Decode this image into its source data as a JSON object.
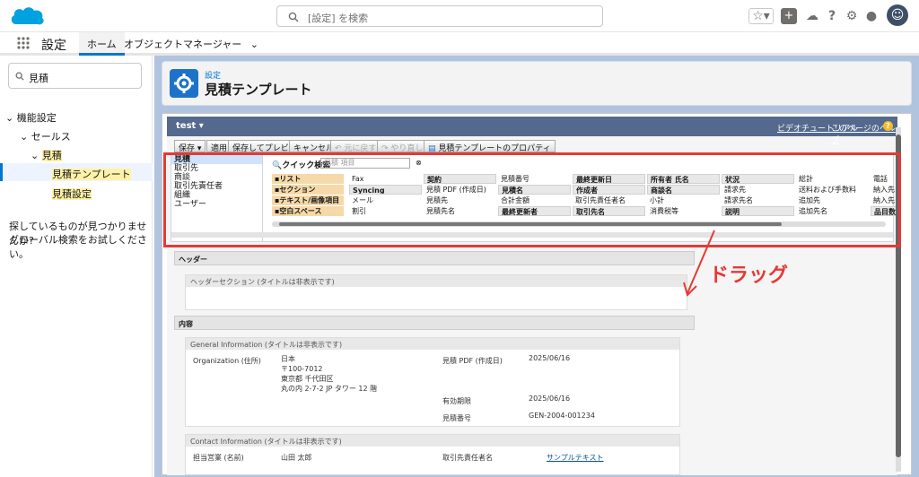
{
  "topbar": {
    "search_placeholder": "[設定] を検索"
  },
  "appbar": {
    "app_name": "設定",
    "tabs": [
      "ホーム",
      "オブジェクトマネージャー"
    ]
  },
  "sidebar": {
    "quickfind_value": "見積",
    "tree": [
      "機能設定",
      "セールス",
      "見積",
      "見積テンプレート",
      "見積設定"
    ],
    "notfound": "探しているものが見つかりませんか?",
    "global": "グローバル検索をお試しください。"
  },
  "header": {
    "breadcrumb": "設定",
    "title": "見積テンプレート"
  },
  "editor": {
    "name": "test",
    "help1": "ビデオチュートリアル",
    "help2": "このページのヘルプ",
    "toolbar": [
      "保存",
      "適用",
      "保存してプレビュー",
      "キャンセル",
      "元に戻す",
      "やり直し",
      "見積テンプレートのプロパティ"
    ],
    "objects": [
      "見積",
      "取引先",
      "商談",
      "取引先責任者",
      "組織",
      "ユーザー"
    ],
    "quicksearch_label": "クイック検索",
    "quicksearch_placeholder": "見積 項目",
    "palette_special": [
      "リスト",
      "セクション",
      "テキスト/画像項目",
      "空白スペース"
    ],
    "palette_cols": [
      [
        "Fax",
        "Syncing",
        "メール",
        "割引"
      ],
      [
        "契約",
        "見積 PDF (作成日)",
        "見積先",
        "見積先名"
      ],
      [
        "見積番号",
        "見積名",
        "合計金額",
        "最終更新者"
      ],
      [
        "最終更新日",
        "作成者",
        "取引先責任者名",
        "取引先名"
      ],
      [
        "所有者 氏名",
        "商談名",
        "小計",
        "消費税等"
      ],
      [
        "状況",
        "請求先",
        "請求先名",
        "説明"
      ],
      [
        "総計",
        "送料および手数料",
        "追加先",
        "追加先名"
      ],
      [
        "電話",
        "納入先",
        "納入先",
        "品目数"
      ]
    ],
    "sections": {
      "header": "ヘッダー",
      "header_section": "ヘッダーセクション (タイトルは非表示です)",
      "content": "内容",
      "general": "General Information (タイトルは非表示です)",
      "contact": "Contact Information (タイトルは非表示です)"
    },
    "fields": {
      "org_label": "Organization (住所)",
      "org_value": [
        "日本",
        "〒100-7012",
        "東京都 千代田区",
        "丸の内 2-7-2 JP タワー 12 階"
      ],
      "pdf_label": "見積 PDF (作成日)",
      "pdf_value": "2025/06/16",
      "exp_label": "有効期限",
      "exp_value": "2025/06/16",
      "num_label": "見積番号",
      "num_value": "GEN-2004-001234",
      "rep_label": "担当営業 (名前)",
      "rep_value": "山田 太郎",
      "contact_label": "取引先責任者名",
      "contact_value": "サンプルテキスト"
    }
  },
  "annotation": "ドラッグ"
}
